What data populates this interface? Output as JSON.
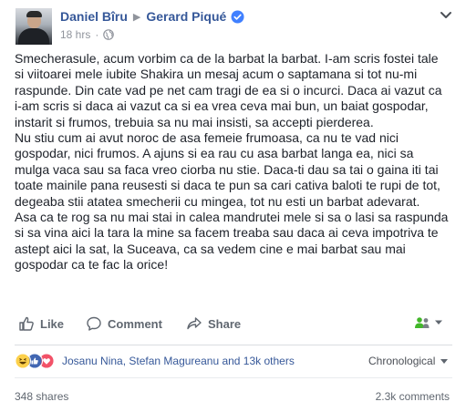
{
  "header": {
    "author": "Daniel Bîru",
    "target": "Gerard Piqué",
    "time": "18 hrs",
    "dot": "·",
    "verified_icon": "verified-badge-icon",
    "privacy_icon": "globe-icon"
  },
  "post": {
    "lines": [
      "Smecherasule, acum vorbim ca de la barbat la barbat. I-am scris fostei tale",
      "si viitoarei mele iubite Shakira un mesaj acum o saptamana si tot nu-mi",
      "raspunde. Din cate vad pe net cam tragi de ea si o incurci. Daca ai vazut ca",
      "i-am scris si daca ai vazut ca si ea vrea ceva mai bun, un baiat gospodar,",
      "instarit si frumos, trebuia sa nu mai insisti, sa accepti pierderea.",
      "Nu stiu cum ai avut noroc de asa femeie frumoasa, ca nu te vad nici",
      "gospodar, nici frumos. A ajuns si ea rau cu asa barbat langa ea, nici sa",
      "mulga vaca sau sa faca vreo ciorba nu stie. Daca-ti dau sa tai o gaina iti tai",
      "toate mainile pana reusesti si daca te pun sa cari cativa baloti te rupi de tot,",
      "degeaba stii atatea smecherii cu mingea, tot nu esti un barbat adevarat.",
      "Asa ca te rog sa nu mai stai in calea mandrutei mele si sa o lasi sa raspunda",
      "si sa vina aici la tara la mine sa facem treaba sau daca ai ceva impotriva te",
      "astept aici la sat, la Suceava, ca sa vedem cine e mai barbat sau mai",
      "gospodar ca te fac la orice!"
    ]
  },
  "actions": {
    "like": "Like",
    "comment": "Comment",
    "share": "Share"
  },
  "reactions": {
    "names": "Josanu Nina, Stefan Magureanu and 13k others",
    "order": "Chronological",
    "icons": [
      "haha-icon",
      "like-icon",
      "love-icon"
    ]
  },
  "stats": {
    "shares": "348 shares",
    "comments": "2.3k comments"
  },
  "colors": {
    "link": "#365899",
    "like_blue": "#4267b2",
    "love_red": "#f25268",
    "haha_yellow": "#fcd04b"
  }
}
